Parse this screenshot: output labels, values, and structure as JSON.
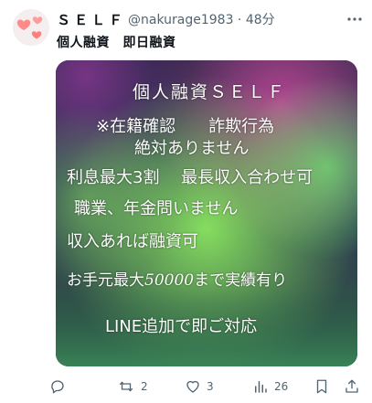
{
  "post": {
    "display_name": "ＳＥＬＦ",
    "handle_time": "@nakurage1983 · 48分",
    "text": "個人融資　即日融資"
  },
  "image_lines": {
    "line1": "個人融資ＳＥＬＦ",
    "line2": "※在籍確認　　詐欺行為",
    "line3": "絶対ありません",
    "line4": "利息最大3割　 最長収入合わせ可",
    "line5": "職業、年金問いません",
    "line6": "収入あれば融資可",
    "line7a": "お手元最大",
    "line7b": "50000",
    "line7c": "まで実績有り",
    "line8": "LINE追加で即ご対応"
  },
  "actions": {
    "reply_count": "",
    "repost_count": "2",
    "like_count": "3",
    "view_count": "26"
  },
  "colors": {
    "aurora_green": "#7fe05a",
    "aurora_pink": "#d04aa0",
    "sky_dark": "#252c4a"
  }
}
